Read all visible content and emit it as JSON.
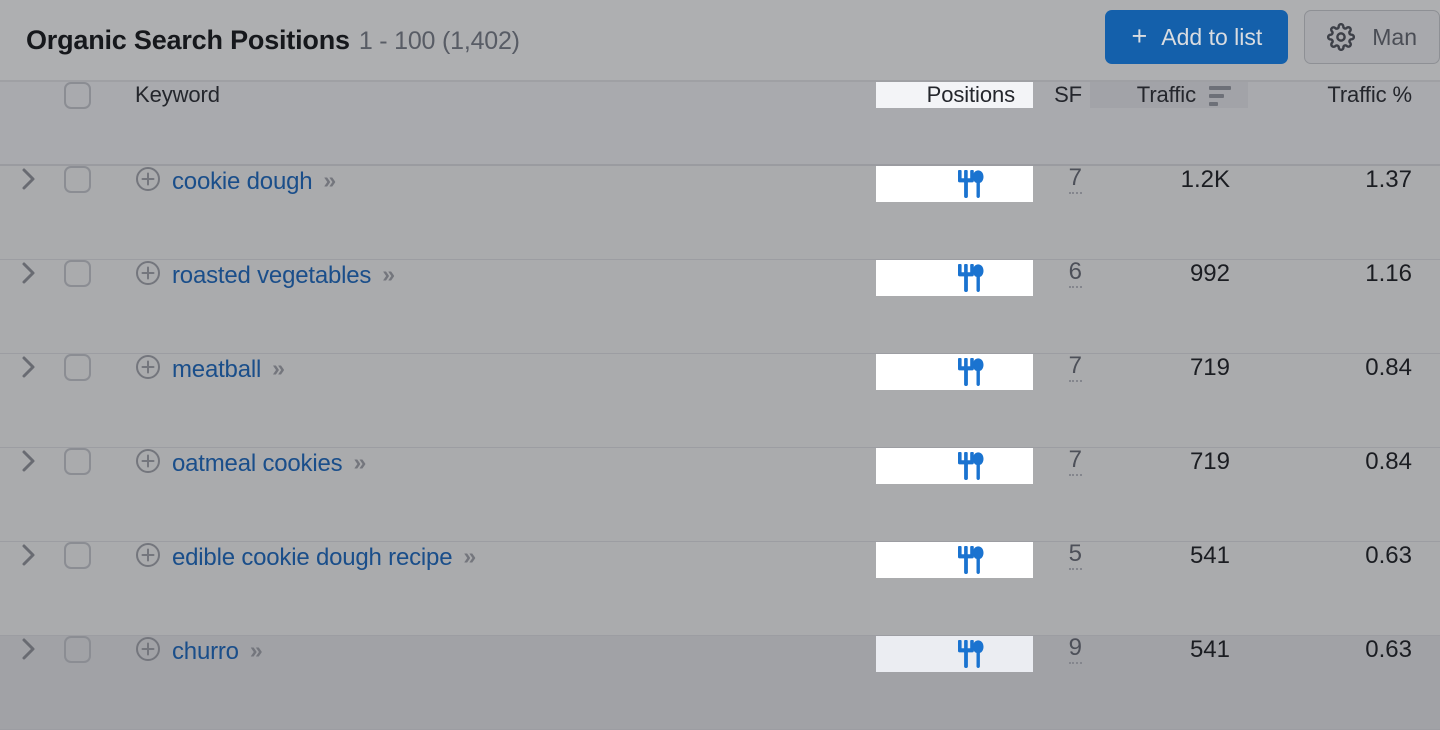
{
  "header": {
    "title": "Organic Search Positions",
    "range": "1 - 100 (1,402)",
    "add_to_list_label": "Add to list",
    "add_to_list_plus": "+",
    "manage_columns_label": "Man",
    "gear_icon_name": "gear-icon"
  },
  "colors": {
    "primary_button": "#1460ab",
    "keyword_link": "#1a4e8a",
    "serp_feature_icon": "#1a73d0",
    "page_background": "#aaabad",
    "positions_column_highlight": "#ffffff",
    "sorted_header_background": "#a2a3a8"
  },
  "table": {
    "columns": [
      {
        "key": "expand",
        "label": ""
      },
      {
        "key": "select",
        "label": ""
      },
      {
        "key": "keyword",
        "label": "Keyword"
      },
      {
        "key": "positions",
        "label": "Positions"
      },
      {
        "key": "sf",
        "label": "SF"
      },
      {
        "key": "traffic",
        "label": "Traffic"
      },
      {
        "key": "traffic_pct",
        "label": "Traffic %"
      }
    ],
    "sort": {
      "column": "Traffic",
      "direction": "desc",
      "icon": "sort-descending-icon"
    },
    "rows": [
      {
        "keyword": "cookie dough",
        "arrows": "»",
        "positions_feature": "restaurant-utensils-icon",
        "sf": "7",
        "traffic": "1.2K",
        "traffic_pct": "1.37",
        "hovered": false
      },
      {
        "keyword": "roasted vegetables",
        "arrows": "»",
        "positions_feature": "restaurant-utensils-icon",
        "sf": "6",
        "traffic": "992",
        "traffic_pct": "1.16",
        "hovered": false
      },
      {
        "keyword": "meatball",
        "arrows": "»",
        "positions_feature": "restaurant-utensils-icon",
        "sf": "7",
        "traffic": "719",
        "traffic_pct": "0.84",
        "hovered": false
      },
      {
        "keyword": "oatmeal cookies",
        "arrows": "»",
        "positions_feature": "restaurant-utensils-icon",
        "sf": "7",
        "traffic": "719",
        "traffic_pct": "0.84",
        "hovered": false
      },
      {
        "keyword": "edible cookie dough recipe",
        "arrows": "»",
        "positions_feature": "restaurant-utensils-icon",
        "sf": "5",
        "traffic": "541",
        "traffic_pct": "0.63",
        "hovered": false
      },
      {
        "keyword": "churro",
        "arrows": "»",
        "positions_feature": "restaurant-utensils-icon",
        "sf": "9",
        "traffic": "541",
        "traffic_pct": "0.63",
        "hovered": true
      }
    ]
  }
}
